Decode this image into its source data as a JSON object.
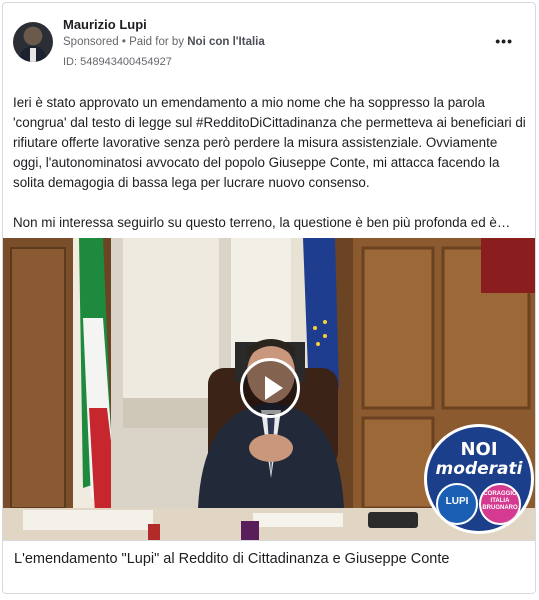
{
  "post": {
    "author": "Maurizio Lupi",
    "sponsored": "Sponsored",
    "dot": "•",
    "paid_for_prefix": "Paid for by",
    "paid_for_by": "Noi con l'Italia",
    "ad_id": "ID: 548943400454927",
    "more_label": "•••",
    "paragraph1": "Ieri è stato approvato un emendamento a mio nome che ha soppresso la parola 'congrua' dal testo di legge sul #RedditoDiCittadinanza che permetteva ai beneficiari di rifiutare offerte lavorative senza però perdere la misura assistenziale. Ovviamente oggi, l'autonominatosi avvocato del popolo Giuseppe Conte, mi attacca facendo la solita demagogia di bassa lega per lucrare nuovo consenso.",
    "paragraph2": "Non mi interessa seguirlo su questo terreno, la questione è ben più profonda ed è…"
  },
  "video": {
    "caption": "L'emendamento \"Lupi\" al Reddito di Cittadinanza e Giuseppe Conte",
    "logo_line1": "NOI",
    "logo_line2": "moderati",
    "logo_left": "LUPI",
    "logo_right": "CORAGGIO ITALIA BRUGNARO"
  },
  "colors": {
    "brand_blue": "#1c3f8c",
    "pink": "#d43a8f"
  }
}
